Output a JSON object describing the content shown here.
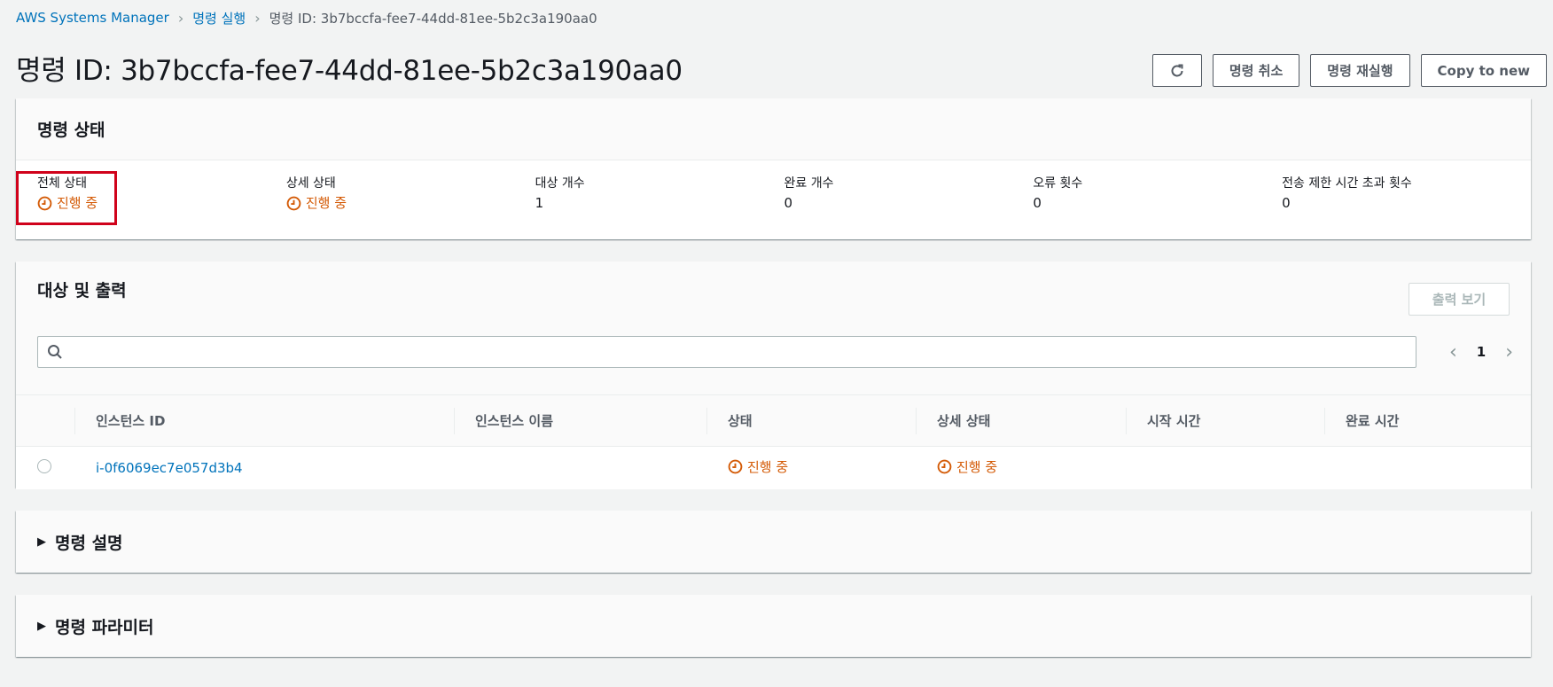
{
  "breadcrumb": {
    "items": [
      "AWS Systems Manager",
      "명령 실행"
    ],
    "current": "명령 ID: 3b7bccfa-fee7-44dd-81ee-5b2c3a190aa0"
  },
  "header": {
    "title": "명령 ID: 3b7bccfa-fee7-44dd-81ee-5b2c3a190aa0",
    "buttons": {
      "cancel": "명령 취소",
      "rerun": "명령 재실행",
      "copy": "Copy to new"
    }
  },
  "status_panel": {
    "title": "명령 상태",
    "fields": [
      {
        "label": "전체 상태",
        "value": "진행 중",
        "type": "status"
      },
      {
        "label": "상세 상태",
        "value": "진행 중",
        "type": "status"
      },
      {
        "label": "대상 개수",
        "value": "1",
        "type": "text"
      },
      {
        "label": "완료 개수",
        "value": "0",
        "type": "text"
      },
      {
        "label": "오류 횟수",
        "value": "0",
        "type": "text"
      },
      {
        "label": "전송 제한 시간 초과 횟수",
        "value": "0",
        "type": "text"
      }
    ]
  },
  "targets_panel": {
    "title": "대상 및 출력",
    "view_output": "출력 보기",
    "search_placeholder": "",
    "page": "1",
    "columns": [
      "인스턴스 ID",
      "인스턴스 이름",
      "상태",
      "상세 상태",
      "시작 시간",
      "완료 시간"
    ],
    "rows": [
      {
        "instance_id": "i-0f6069ec7e057d3b4",
        "instance_name": "",
        "status": "진행 중",
        "detail_status": "진행 중",
        "start": "",
        "end": ""
      }
    ]
  },
  "collapsibles": {
    "description": "명령 설명",
    "parameters": "명령 파라미터"
  },
  "colors": {
    "in_progress": "#d45b07",
    "link": "#0073bb",
    "highlight": "#d0021b"
  }
}
